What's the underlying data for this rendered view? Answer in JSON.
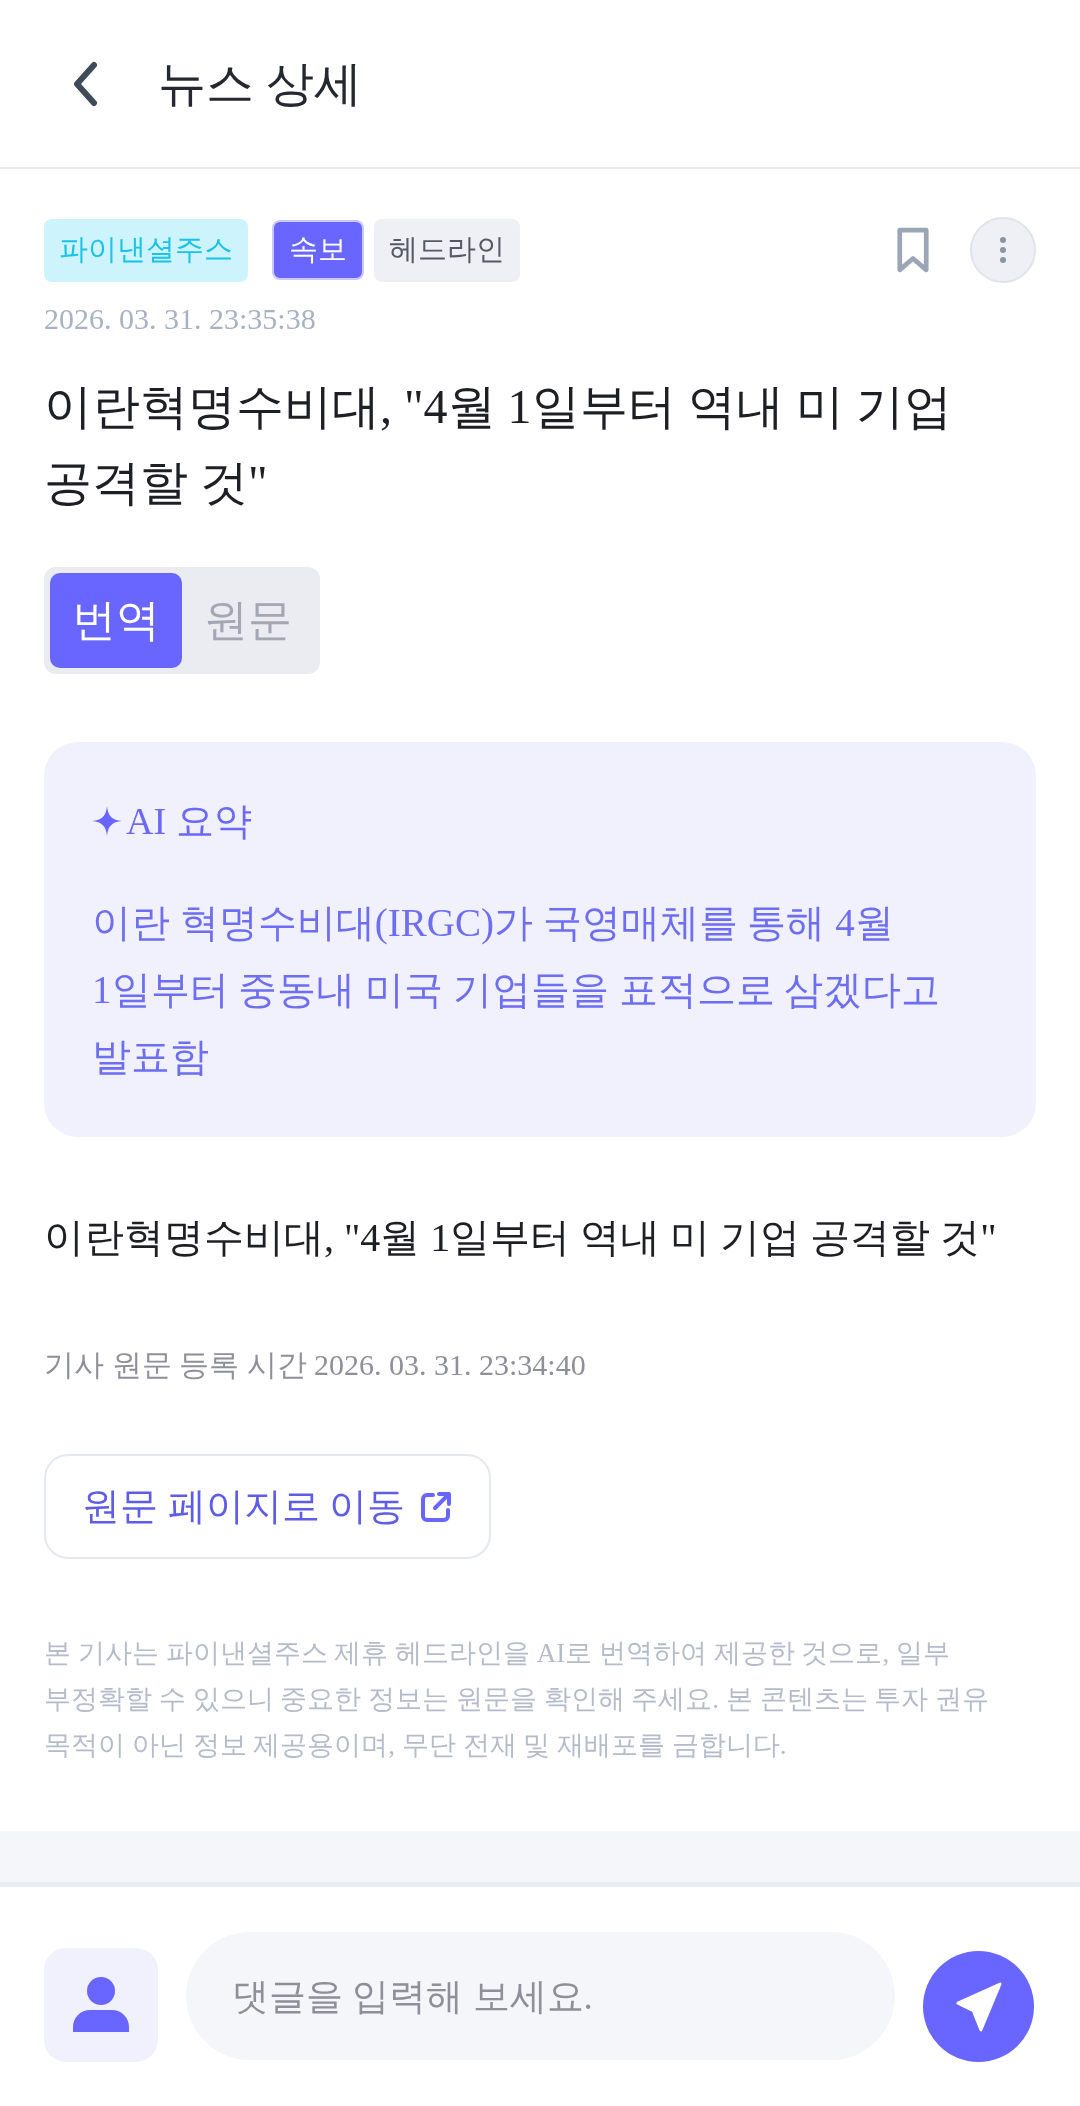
{
  "header": {
    "title": "뉴스 상세"
  },
  "article": {
    "tags": [
      {
        "label": "파이낸셜주스",
        "kind": "source"
      },
      {
        "label": "속보",
        "kind": "breaking"
      },
      {
        "label": "헤드라인",
        "kind": "category"
      }
    ],
    "bookmarked": false,
    "published": "2026. 03. 31. 23:35:38",
    "title": "이란혁명수비대, \"4월 1일부터 역내 미 기업 공격할 것\"",
    "view_tabs": [
      {
        "label": "번역",
        "selected": true
      },
      {
        "label": "원문",
        "selected": false
      }
    ],
    "ai_summary": {
      "title": "AI 요약",
      "text": "이란 혁명수비대(IRGC)가 국영매체를 통해 4월 1일부터 중동내 미국 기업들을 표적으로 삼겠다고 발표함"
    },
    "body": "이란혁명수비대, \"4월 1일부터 역내 미 기업 공격할 것\"",
    "source_time": "기사 원문 등록 시간 2026. 03. 31. 23:34:40",
    "source_link": "원문 페이지로 이동",
    "disclaimer": "본 기사는 파이낸셜주스 제휴 헤드라인을 AI로 번역하여 제공한 것으로, 일부 부정확할 수 있으니 중요한 정보는 원문을 확인해 주세요. 본 콘텐츠는 투자 권유 목적이 아닌 정보 제공용이며, 무단 전재 및 재배포를 금합니다."
  },
  "comment_bar": {
    "placeholder": "댓글을 입력해 보세요."
  }
}
